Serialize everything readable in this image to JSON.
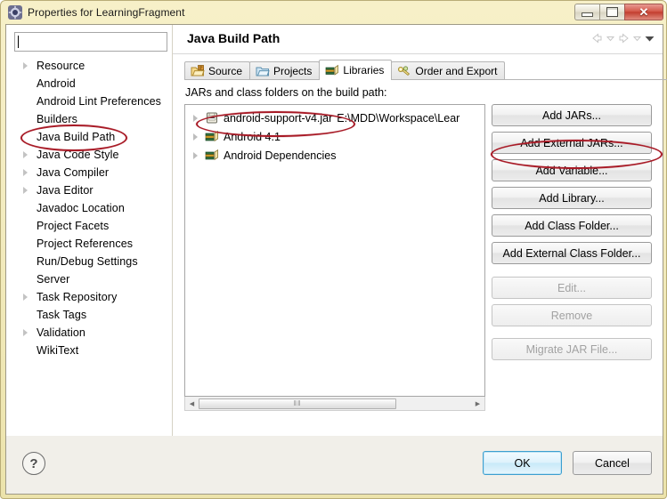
{
  "window": {
    "title": "Properties for LearningFragment",
    "icon": "eclipse-properties-icon",
    "controls": {
      "minimize": "minimize-button",
      "restore": "restore-button",
      "close": "close-button",
      "close_glyph": "✕"
    }
  },
  "sidebar": {
    "filter": {
      "value": "",
      "placeholder": ""
    },
    "items": [
      {
        "label": "Resource",
        "expandable": true
      },
      {
        "label": "Android",
        "expandable": false
      },
      {
        "label": "Android Lint Preferences",
        "expandable": false
      },
      {
        "label": "Builders",
        "expandable": false
      },
      {
        "label": "Java Build Path",
        "expandable": false,
        "highlighted": true
      },
      {
        "label": "Java Code Style",
        "expandable": true
      },
      {
        "label": "Java Compiler",
        "expandable": true
      },
      {
        "label": "Java Editor",
        "expandable": true
      },
      {
        "label": "Javadoc Location",
        "expandable": false
      },
      {
        "label": "Project Facets",
        "expandable": false
      },
      {
        "label": "Project References",
        "expandable": false
      },
      {
        "label": "Run/Debug Settings",
        "expandable": false
      },
      {
        "label": "Server",
        "expandable": false
      },
      {
        "label": "Task Repository",
        "expandable": true
      },
      {
        "label": "Task Tags",
        "expandable": false
      },
      {
        "label": "Validation",
        "expandable": true
      },
      {
        "label": "WikiText",
        "expandable": false
      }
    ],
    "scrollbar": {
      "left_arrow": "◀",
      "right_arrow": "▶",
      "grip": "‖‖"
    }
  },
  "page": {
    "title": "Java Build Path",
    "nav": {
      "back": "back-arrow",
      "back_menu": "back-dropdown",
      "forward": "forward-arrow",
      "forward_menu": "forward-dropdown",
      "menu": "view-menu"
    },
    "tabs": [
      {
        "label": "Source",
        "icon": "source-folder-icon",
        "active": false
      },
      {
        "label": "Projects",
        "icon": "projects-folder-icon",
        "active": false
      },
      {
        "label": "Libraries",
        "icon": "libraries-books-icon",
        "active": true
      },
      {
        "label": "Order and Export",
        "icon": "order-export-icon",
        "active": false
      }
    ],
    "list_label": "JARs and class folders on the build path:",
    "entries": [
      {
        "name": "android-support-v4.jar",
        "path": "E:\\MDD\\Workspace\\Lear",
        "icon": "jar-icon",
        "expandable": true,
        "highlighted": true
      },
      {
        "name": "Android 4.1",
        "path": "",
        "icon": "libraries-books-icon",
        "expandable": true,
        "highlighted": false
      },
      {
        "name": "Android Dependencies",
        "path": "",
        "icon": "libraries-books-icon",
        "expandable": true,
        "highlighted": false
      }
    ],
    "list_scrollbar": {
      "left_arrow": "◀",
      "right_arrow": "▶",
      "grip": "‖‖"
    },
    "buttons": [
      {
        "label": "Add JARs...",
        "enabled": true,
        "highlighted": false
      },
      {
        "label": "Add External JARs...",
        "enabled": true,
        "highlighted": true
      },
      {
        "label": "Add Variable...",
        "enabled": true,
        "highlighted": false
      },
      {
        "label": "Add Library...",
        "enabled": true,
        "highlighted": false
      },
      {
        "label": "Add Class Folder...",
        "enabled": true,
        "highlighted": false
      },
      {
        "label": "Add External Class Folder...",
        "enabled": true,
        "highlighted": false
      },
      {
        "label": "Edit...",
        "enabled": false,
        "highlighted": false
      },
      {
        "label": "Remove",
        "enabled": false,
        "highlighted": false
      },
      {
        "label": "Migrate JAR File...",
        "enabled": false,
        "highlighted": false
      }
    ]
  },
  "footer": {
    "help": "?",
    "ok": "OK",
    "cancel": "Cancel"
  },
  "colors": {
    "annotation_red": "#a81a26",
    "titlebar_gold": "#f3ecc0",
    "ok_accent": "#3c9fd0"
  }
}
